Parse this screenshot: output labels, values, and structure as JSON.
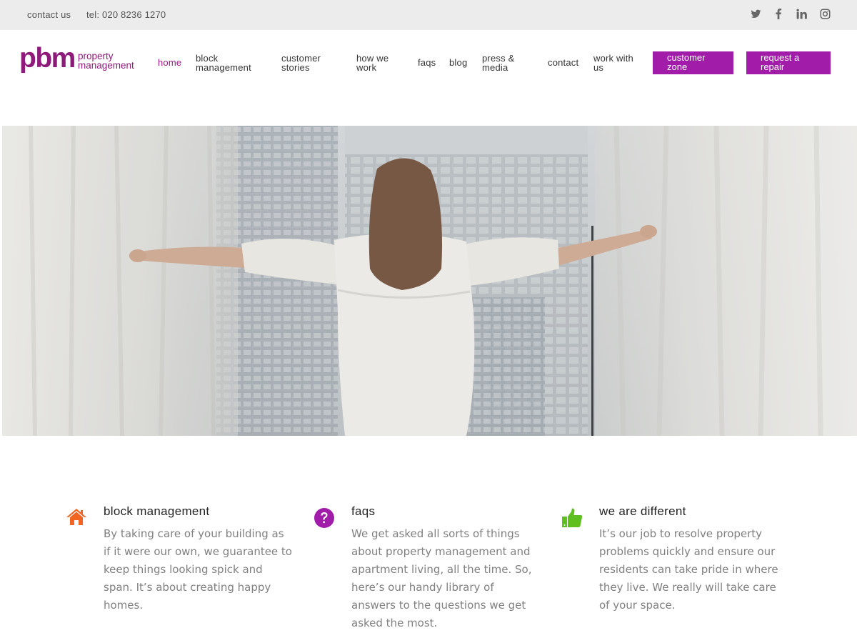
{
  "topbar": {
    "contact_label": "contact us",
    "phone_label": "tel: 020 8236 1270",
    "social_icons": [
      "twitter-icon",
      "facebook-icon",
      "linkedin-icon",
      "instagram-icon"
    ]
  },
  "logo": {
    "mark": "pbm",
    "line1": "property",
    "line2": "management"
  },
  "nav": {
    "items": [
      {
        "line1": "home",
        "line2": ""
      },
      {
        "line1": "block",
        "line2": "management"
      },
      {
        "line1": "customer",
        "line2": "stories"
      },
      {
        "line1": "how we",
        "line2": "work"
      },
      {
        "line1": "faqs",
        "line2": ""
      },
      {
        "line1": "blog",
        "line2": ""
      },
      {
        "line1": "press &",
        "line2": "media"
      },
      {
        "line1": "contact",
        "line2": ""
      },
      {
        "line1": "work with",
        "line2": "us"
      }
    ],
    "buttons": [
      {
        "line1": "customer",
        "line2": "zone"
      },
      {
        "line1": "request a",
        "line2": "repair"
      }
    ]
  },
  "features": [
    {
      "icon": "home-icon",
      "title": "block management",
      "text": "By taking care of your building as if it were our own, we guarantee to keep things looking spick and span. It’s about creating happy homes."
    },
    {
      "icon": "question-circle-icon",
      "title": "faqs",
      "text": "We get asked all sorts of things about property management and apartment living, all the time. So, here’s our handy library of answers to the questions we get asked the most."
    },
    {
      "icon": "thumbs-up-icon",
      "title": "we are different",
      "text": "It’s our job to resolve property problems quickly and ensure our residents can take pride in where they live. We really will take care of your space."
    }
  ],
  "colors": {
    "brand": "#8e1a7a",
    "button": "#a11ca9",
    "topbar_bg": "#ececec",
    "home_icon": "#f26522",
    "faq_icon": "#a11ca9",
    "thumb_icon": "#5fbf1f"
  }
}
